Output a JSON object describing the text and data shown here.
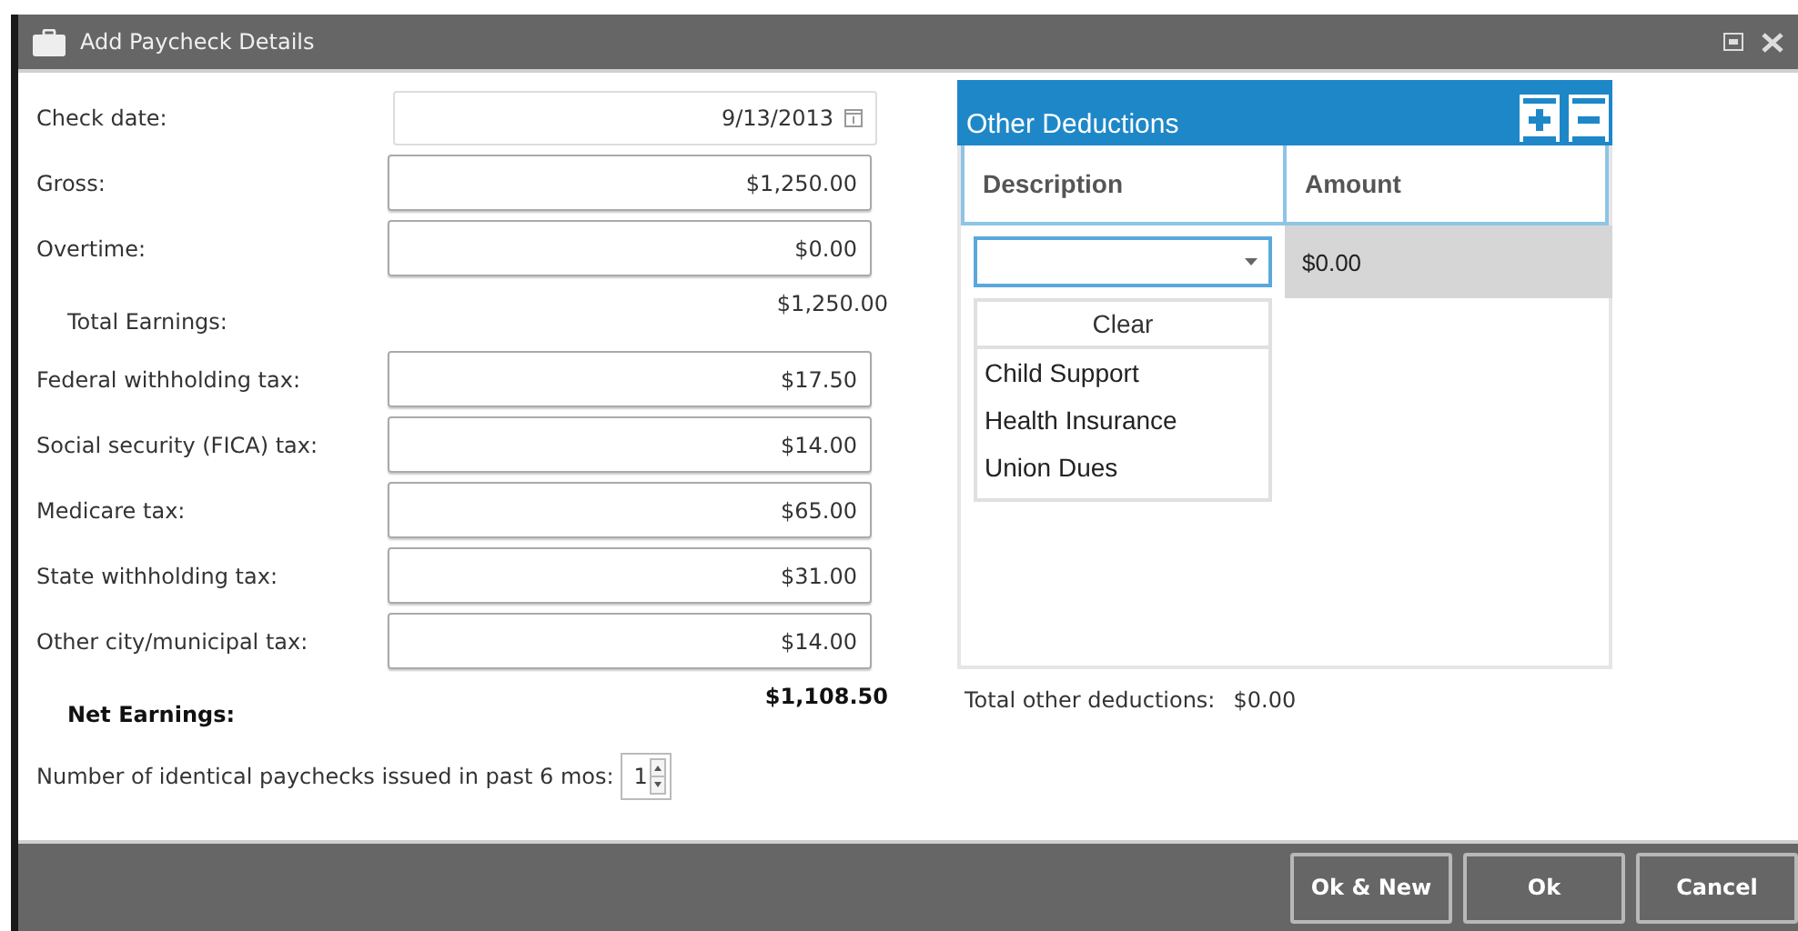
{
  "window": {
    "title": "Add Paycheck Details"
  },
  "form": {
    "rows": [
      {
        "kind": "date",
        "label": "Check date:",
        "value": "9/13/2013"
      },
      {
        "kind": "input",
        "label": "Gross:",
        "value": "$1,250.00"
      },
      {
        "kind": "input",
        "label": "Overtime:",
        "value": "$0.00"
      },
      {
        "kind": "total",
        "label": "Total Earnings:",
        "value": "$1,250.00"
      },
      {
        "kind": "input",
        "label": "Federal withholding tax:",
        "value": "$17.50"
      },
      {
        "kind": "input",
        "label": "Social security (FICA) tax:",
        "value": "$14.00"
      },
      {
        "kind": "input",
        "label": "Medicare tax:",
        "value": "$65.00"
      },
      {
        "kind": "input",
        "label": "State withholding tax:",
        "value": "$31.00"
      },
      {
        "kind": "input",
        "label": "Other city/municipal tax:",
        "value": "$14.00"
      },
      {
        "kind": "net",
        "label": "Net Earnings:",
        "value": "$1,108.50"
      }
    ],
    "paychecks": {
      "label": "Number of identical paychecks issued in past 6 mos:",
      "value": "1"
    }
  },
  "deductions": {
    "title": "Other Deductions",
    "columns": [
      "Description",
      "Amount"
    ],
    "rows": [
      {
        "amount": "$0.00"
      }
    ],
    "dropdown": {
      "clear": "Clear",
      "options": [
        "Child Support",
        "Health Insurance",
        "Union Dues"
      ]
    },
    "total_label": "Total other deductions:",
    "total_value": "$0.00"
  },
  "buttons": [
    "Ok & New",
    "Ok",
    "Cancel"
  ]
}
